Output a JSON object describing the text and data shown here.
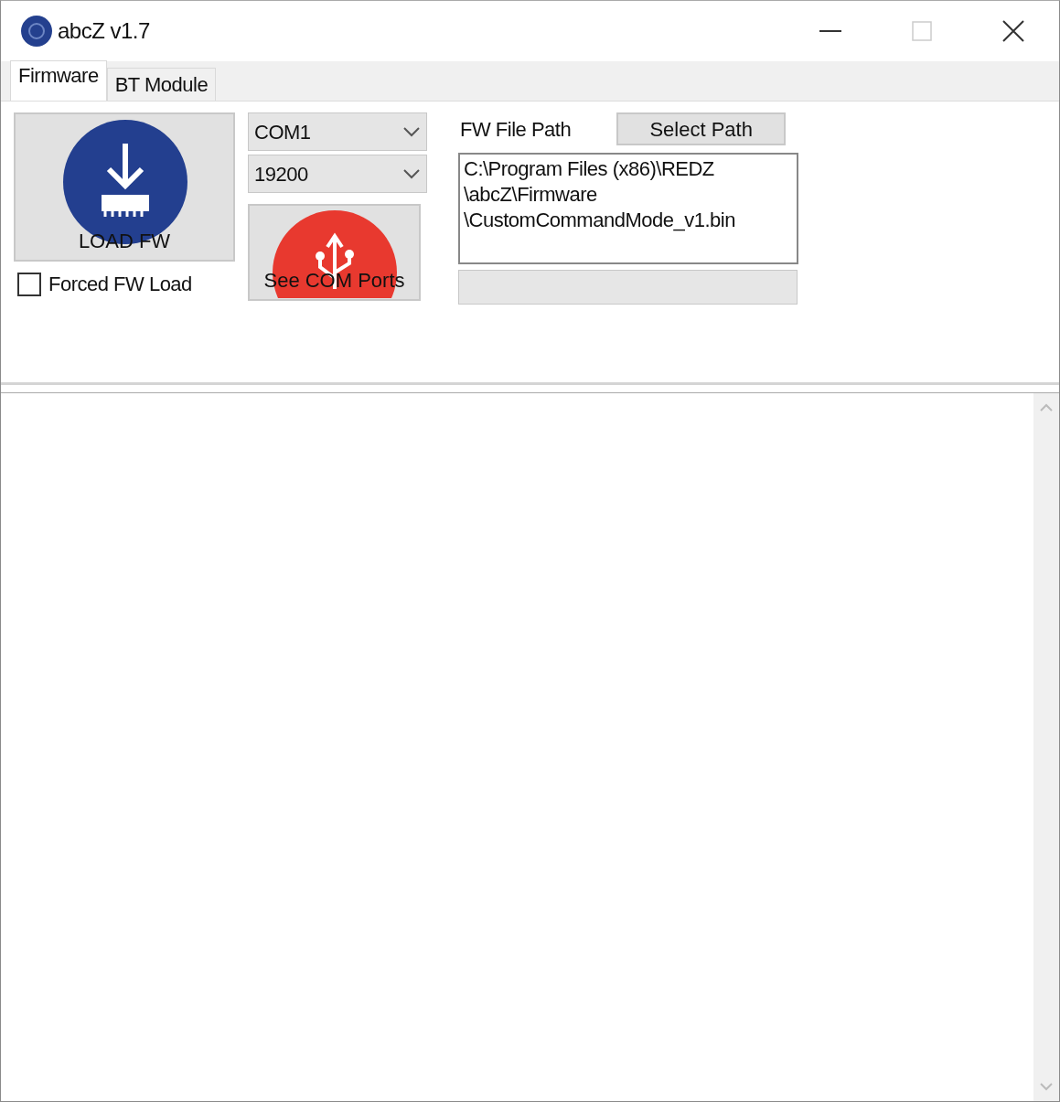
{
  "window": {
    "title": "abcZ v1.7"
  },
  "tabs": [
    {
      "label": "Firmware",
      "selected": true
    },
    {
      "label": "BT Module",
      "selected": false
    }
  ],
  "load_button": {
    "label": "LOAD FW"
  },
  "forced_load": {
    "label": "Forced FW Load",
    "checked": false
  },
  "port_select": {
    "value": "COM1"
  },
  "baud_select": {
    "value": "19200"
  },
  "see_ports_button": {
    "label": "See COM Ports"
  },
  "fw_path": {
    "label": "FW File Path",
    "button": "Select Path",
    "lines": [
      "C:\\Program Files (x86)\\REDZ",
      "\\abcZ\\Firmware",
      "\\CustomCommandMode_v1.bin"
    ]
  }
}
